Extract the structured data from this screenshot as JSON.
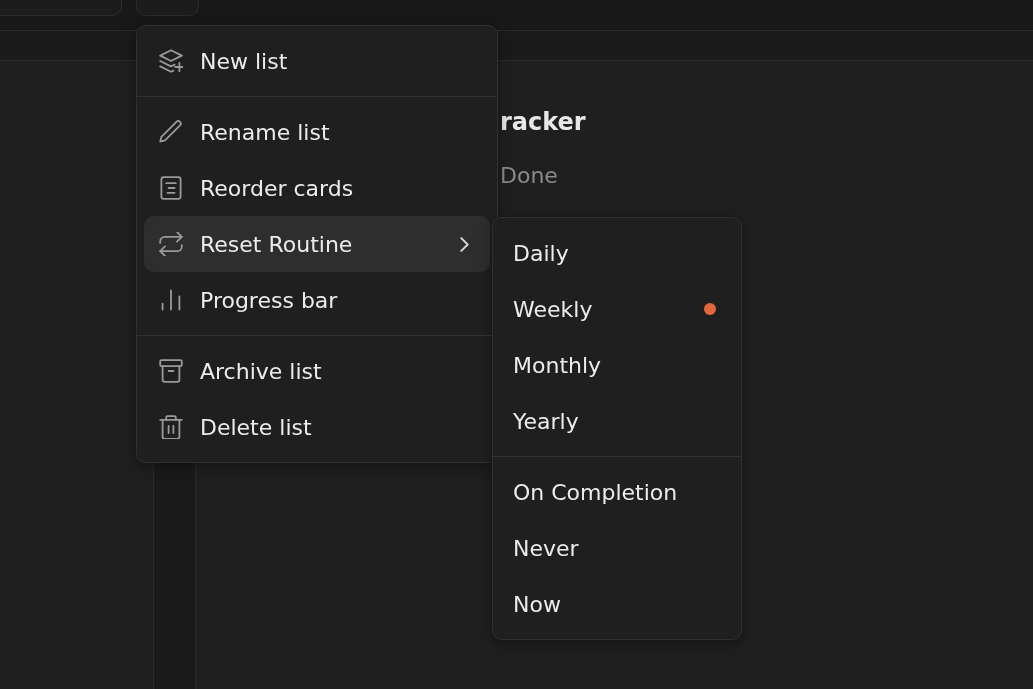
{
  "page": {
    "title": "racker",
    "status": "Done"
  },
  "menu": {
    "groups": [
      [
        {
          "label": "New list",
          "kind": "action",
          "expanded": false
        }
      ],
      [
        {
          "label": "Rename list",
          "kind": "action",
          "expanded": false
        },
        {
          "label": "Reorder cards",
          "kind": "action",
          "expanded": false
        },
        {
          "label": "Reset Routine",
          "kind": "submenu",
          "expanded": true
        },
        {
          "label": "Progress bar",
          "kind": "action",
          "expanded": false
        }
      ],
      [
        {
          "label": "Archive list",
          "kind": "action",
          "expanded": false
        },
        {
          "label": "Delete list",
          "kind": "action",
          "expanded": false
        }
      ]
    ]
  },
  "submenu": {
    "groups": [
      [
        {
          "label": "Daily",
          "selected": false
        },
        {
          "label": "Weekly",
          "selected": true
        },
        {
          "label": "Monthly",
          "selected": false
        },
        {
          "label": "Yearly",
          "selected": false
        }
      ],
      [
        {
          "label": "On Completion",
          "selected": false
        },
        {
          "label": "Never",
          "selected": false
        },
        {
          "label": "Now",
          "selected": false
        }
      ]
    ]
  }
}
